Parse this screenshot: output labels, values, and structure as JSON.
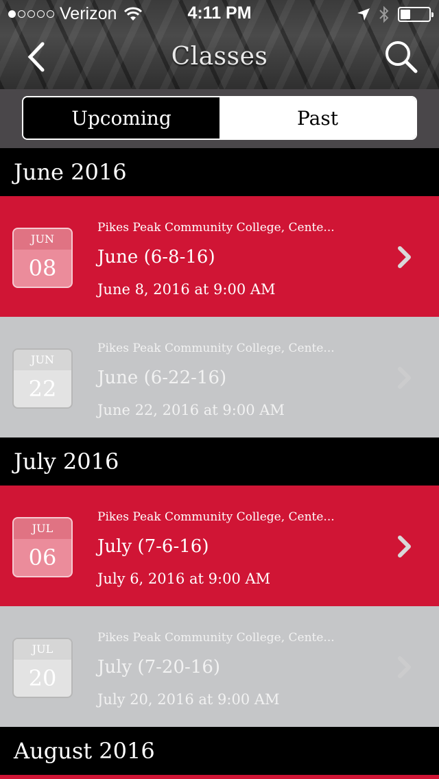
{
  "status_bar": {
    "carrier": "Verizon",
    "time": "4:11 PM",
    "signal_dots_filled": 1,
    "signal_dots_total": 5,
    "battery_level": 0.3
  },
  "nav": {
    "title": "Classes",
    "back_icon": "chevron-left-icon",
    "search_icon": "search-icon"
  },
  "tabs": [
    {
      "label": "Upcoming",
      "active": true
    },
    {
      "label": "Past",
      "active": false
    }
  ],
  "sections": [
    {
      "month": "June 2016",
      "classes": [
        {
          "cal_month": "JUN",
          "cal_day": "08",
          "location": "Pikes Peak Community College, Cente...",
          "title": "June (6-8-16)",
          "datetime": "June 8, 2016 at 9:00 AM",
          "style": "red"
        },
        {
          "cal_month": "JUN",
          "cal_day": "22",
          "location": "Pikes Peak Community College, Cente...",
          "title": "June (6-22-16)",
          "datetime": "June 22, 2016 at 9:00 AM",
          "style": "gray"
        }
      ]
    },
    {
      "month": "July 2016",
      "classes": [
        {
          "cal_month": "JUL",
          "cal_day": "06",
          "location": "Pikes Peak Community College, Cente...",
          "title": "July (7-6-16)",
          "datetime": "July 6, 2016 at 9:00 AM",
          "style": "red"
        },
        {
          "cal_month": "JUL",
          "cal_day": "20",
          "location": "Pikes Peak Community College, Cente...",
          "title": "July (7-20-16)",
          "datetime": "July 20, 2016 at 9:00 AM",
          "style": "gray"
        }
      ]
    },
    {
      "month": "August 2016",
      "classes": []
    }
  ],
  "colors": {
    "accent_red": "#d01535",
    "row_gray": "#c5c6c8",
    "header_black": "#000000"
  }
}
